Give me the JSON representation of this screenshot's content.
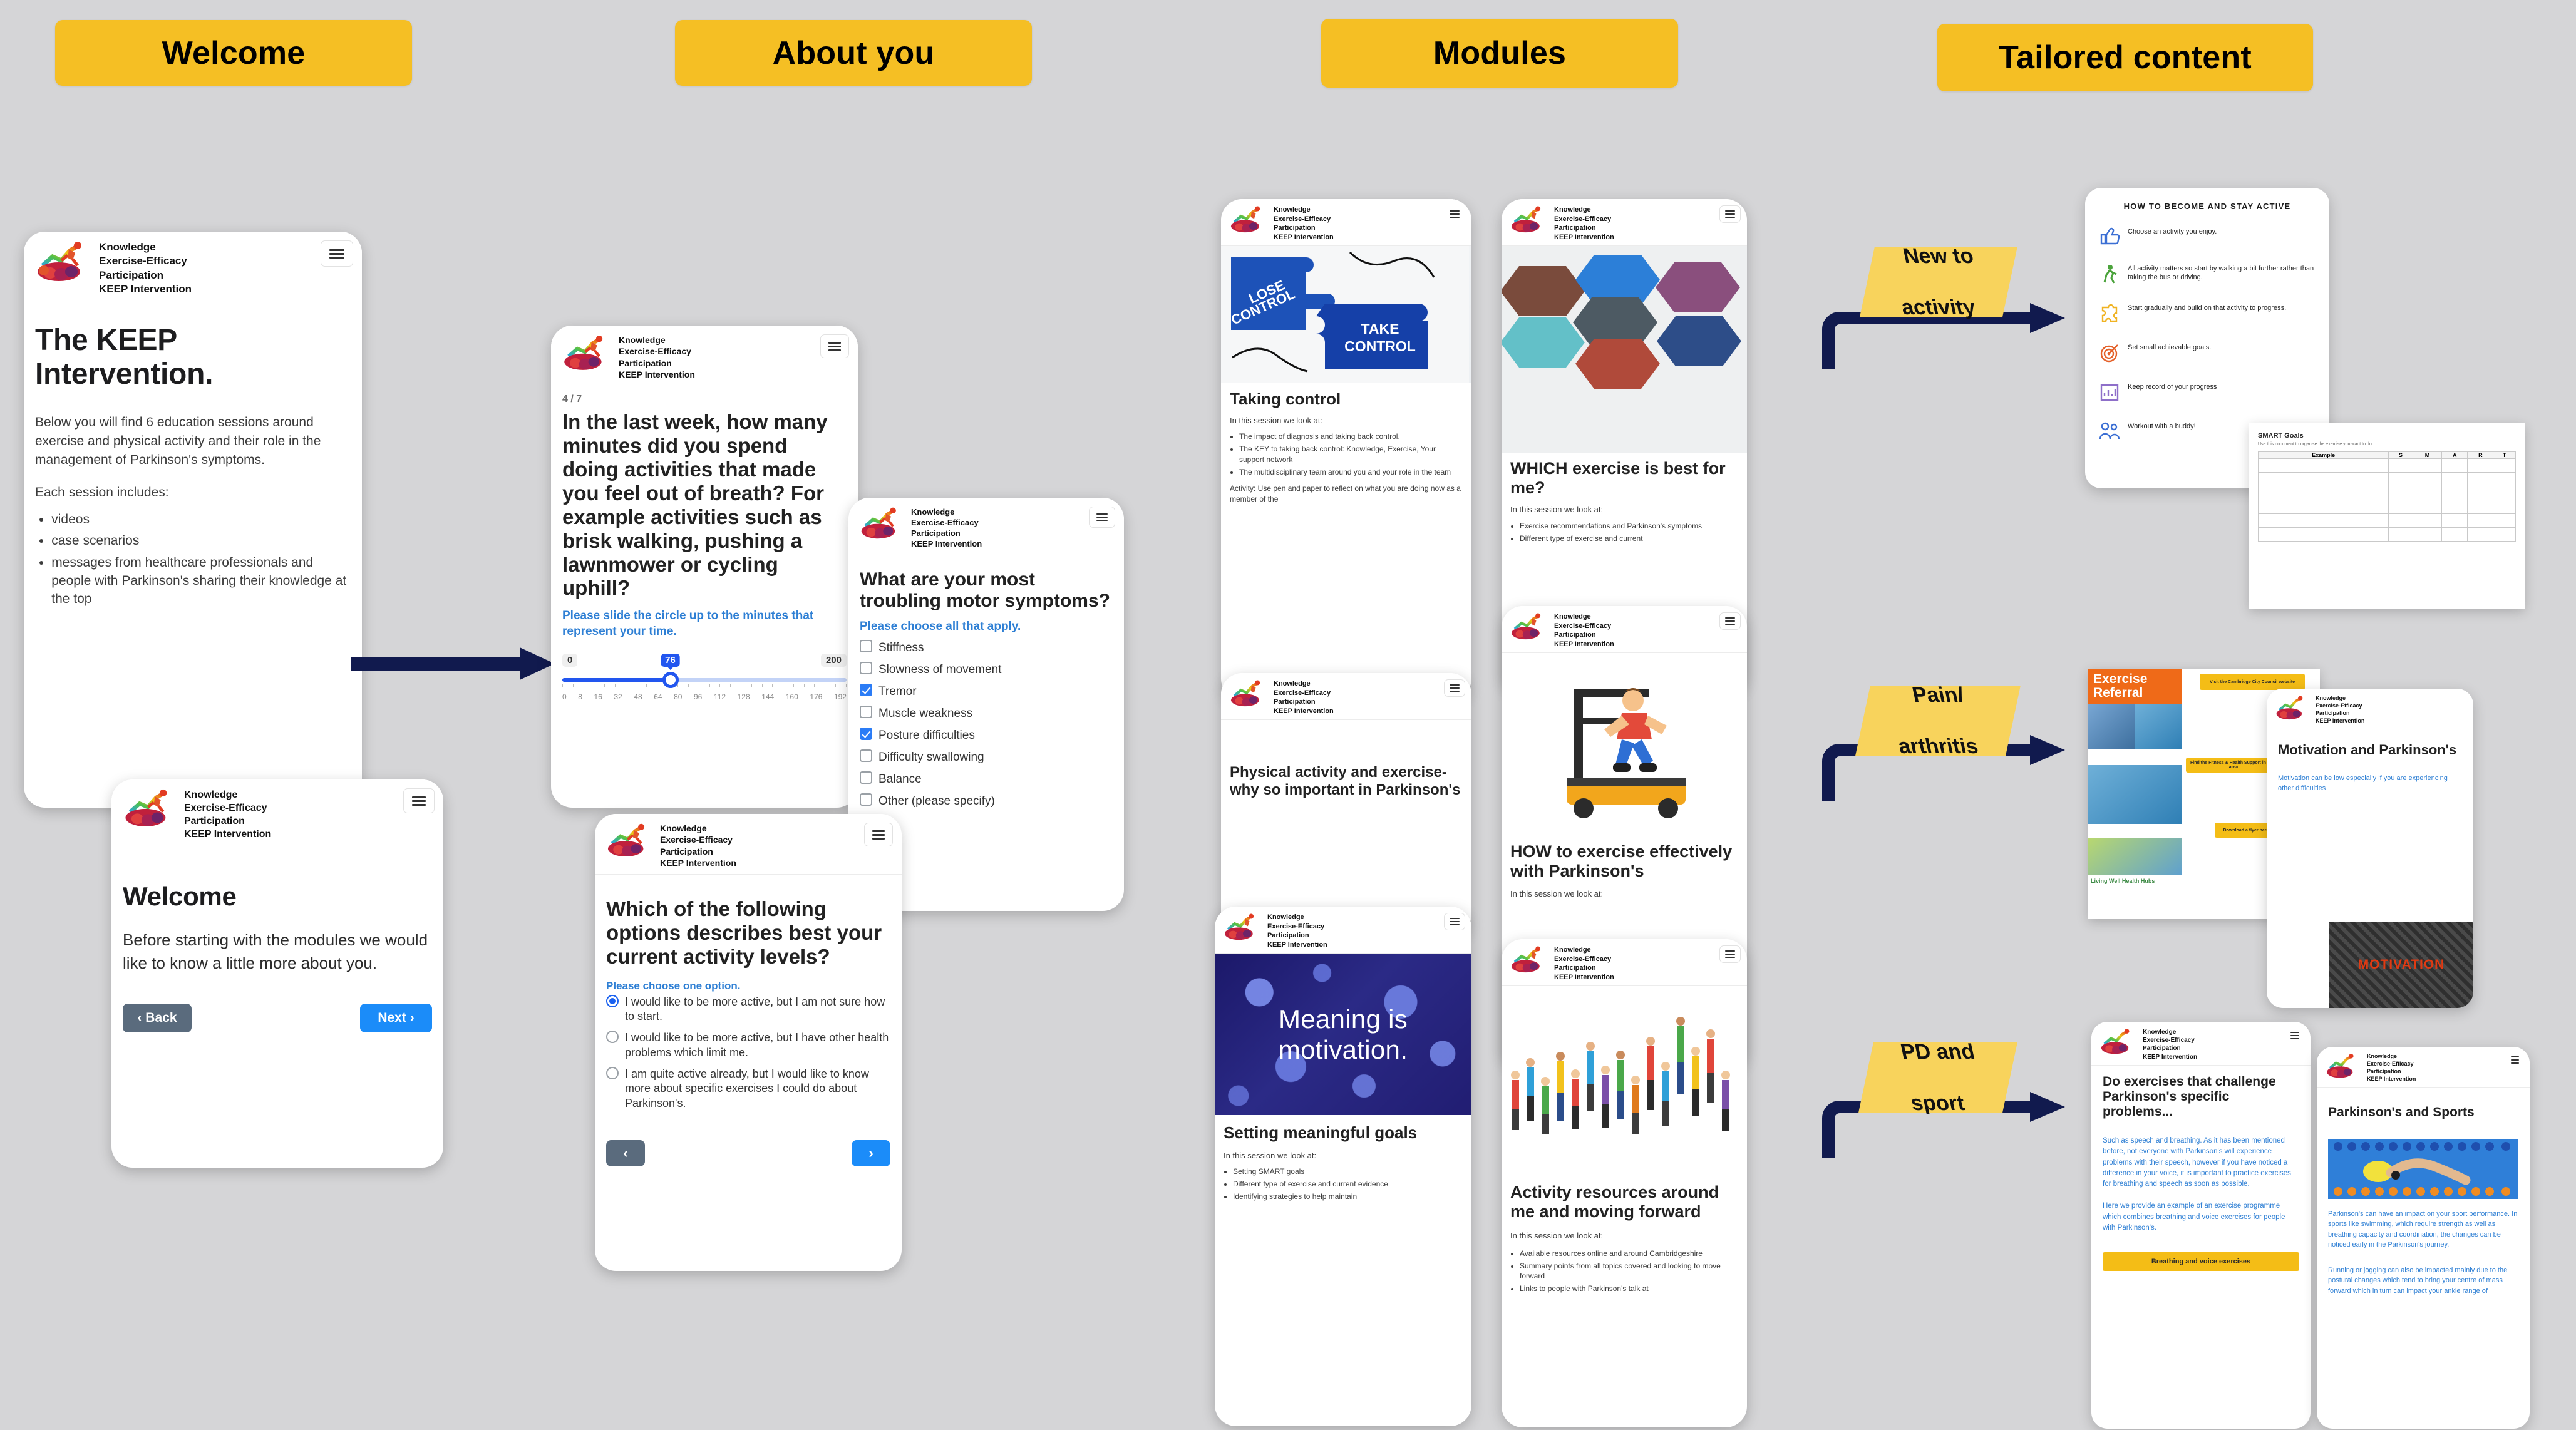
{
  "banners": [
    {
      "label": "Welcome"
    },
    {
      "label": "About you"
    },
    {
      "label": "Modules"
    },
    {
      "label": "Tailored content"
    }
  ],
  "brand": {
    "line1": "Knowledge",
    "line2": "Exercise-Efficacy",
    "line3": "Participation",
    "line4": "KEEP Intervention",
    "logo_icon": "running-figure-logo"
  },
  "welcome_column": {
    "keep_card": {
      "title": "The KEEP Intervention.",
      "paragraph": "Below you will find 6 education sessions around exercise and physical activity and their role in the management of Parkinson's symptoms.",
      "list_intro": "Each session includes:",
      "bullets": [
        "videos",
        "case scenarios",
        "messages from healthcare professionals and people with Parkinson's sharing their knowledge at the top"
      ]
    },
    "welcome_card": {
      "title": "Welcome",
      "paragraph": "Before starting with the modules we would like to know a little more about you.",
      "back_label": "‹ Back",
      "next_label": "Next ›"
    }
  },
  "about_you_column": {
    "minutes_card": {
      "step": "4 / 7",
      "question": "In the last week, how many minutes did you spend doing activities that made you feel out of breath? For example activities such as brisk walking, pushing a lawnmower or cycling uphill?",
      "hint": "Please slide the circle up to the minutes that represent your time.",
      "slider": {
        "min_label": "0",
        "max_label": "200",
        "value": "76",
        "min": 0,
        "max": 200,
        "ticks": [
          "0",
          "8",
          "16",
          "32",
          "48",
          "64",
          "80",
          "96",
          "112",
          "128",
          "144",
          "160",
          "176",
          "192"
        ]
      }
    },
    "symptoms_card": {
      "question": "What are your most troubling motor symptoms?",
      "hint": "Please choose all that apply.",
      "options": [
        {
          "label": "Stiffness",
          "checked": false
        },
        {
          "label": "Slowness of movement",
          "checked": false
        },
        {
          "label": "Tremor",
          "checked": true
        },
        {
          "label": "Muscle weakness",
          "checked": false
        },
        {
          "label": "Posture difficulties",
          "checked": true
        },
        {
          "label": "Difficulty swallowing",
          "checked": false
        },
        {
          "label": "Balance",
          "checked": false
        },
        {
          "label": "Other (please specify)",
          "checked": false
        }
      ]
    },
    "activity_card": {
      "question": "Which of the following options describes best your current activity levels?",
      "hint": "Please choose one option.",
      "options": [
        {
          "label": "I would like to be more active, but I am not sure how to start.",
          "selected": true
        },
        {
          "label": "I would like to be more active, but I have other health problems which limit me.",
          "selected": false
        },
        {
          "label": "I am quite active already, but I would like to know more about specific exercises I could do about Parkinson's.",
          "selected": false
        }
      ],
      "back_label": "‹",
      "next_label": "›"
    }
  },
  "modules_column": {
    "taking_control": {
      "image_left_label": "LOSE CONTROL",
      "image_right_label": "TAKE CONTROL",
      "title": "Taking control",
      "intro": "In this session we look at:",
      "bullets": [
        "The impact of diagnosis and taking back control.",
        "The KEY to taking back control: Knowledge, Exercise, Your support network",
        "The multidisciplinary team around you and your role in the team"
      ],
      "activity": "Activity: Use pen and paper to reflect on what you are doing now as a member of the"
    },
    "physical_activity": {
      "title": "Physical activity and exercise- why so important in Parkinson's"
    },
    "meaningful_goals": {
      "image_caption": "Meaning is motivation.",
      "title": "Setting meaningful goals",
      "intro": "In this session we look at:",
      "bullets": [
        "Setting SMART goals",
        "Different type of exercise and current evidence",
        "Identifying strategies to help maintain"
      ]
    },
    "which_exercise": {
      "title": "WHICH exercise is best for me?",
      "intro": "In this session we look at:",
      "bullets": [
        "Exercise recommendations and Parkinson's symptoms",
        "Different type of exercise and current"
      ]
    },
    "how_to_exercise": {
      "title": "HOW to exercise effectively with Parkinson's",
      "intro": "In this session we look at:"
    },
    "activity_resources": {
      "title": "Activity resources around me and moving forward",
      "intro": "In this session we look at:",
      "bullets": [
        "Available resources online and around Cambridgeshire",
        "Summary points from all topics covered and looking to move forward",
        "Links to people with Parkinson's talk at"
      ]
    }
  },
  "tailored_column": {
    "tags": [
      {
        "line1": "New to",
        "line2": "activity"
      },
      {
        "line1": "Pain/",
        "line2": "arthritis"
      },
      {
        "line1": "PD and",
        "line2": "sport"
      }
    ],
    "active_infographic": {
      "title": "HOW TO BECOME AND STAY ACTIVE",
      "rows": [
        {
          "icon": "thumbs-up-icon",
          "color": "#3b6fd4",
          "text": "Choose an activity you enjoy."
        },
        {
          "icon": "walking-person-icon",
          "color": "#4ba33c",
          "text": "All activity matters so start by walking a bit further rather than taking the bus or driving."
        },
        {
          "icon": "puzzle-piece-icon",
          "color": "#f0b323",
          "text": "Start gradually and build on that activity to progress."
        },
        {
          "icon": "target-icon",
          "color": "#e4612a",
          "text": "Set small achievable goals."
        },
        {
          "icon": "chart-clipboard-icon",
          "color": "#8e6fc9",
          "text": "Keep record of your progress"
        },
        {
          "icon": "people-icon",
          "color": "#3b6fd4",
          "text": "Workout with a buddy!"
        }
      ]
    },
    "smart_goals_sheet": {
      "title": "SMART Goals",
      "subtitle": "Use this document to organise the exercise you want to do.",
      "headers": [
        "Example",
        "S",
        "M",
        "A",
        "R",
        "T"
      ]
    },
    "motivation_card": {
      "title": "Motivation and Parkinson's",
      "body": "Motivation can be low especially if you are experiencing other difficulties",
      "motivation_word": "MOTIVATION"
    },
    "referral_sheet": {
      "heading_line1": "Exercise",
      "heading_line2": "Referral",
      "chips": [
        "Visit the Cambridge City Council website",
        "Find the Fitness & Health Support in your area",
        "Download a flyer here"
      ],
      "footer_title": "Living Well Health Hubs"
    },
    "pd_sport_card": {
      "title": "Do exercises that challenge Parkinson's specific problems...",
      "para1": "Such as speech and breathing. As it has been mentioned before, not everyone with Parkinson's will experience problems with their speech, however if you have noticed a difference in your voice, it is important to practice exercises for breathing and speech as soon as possible.",
      "para2": "Here we provide an example of an exercise programme which combines breathing and voice exercises for people with Parkinson's.",
      "button_label": "Breathing and voice exercises"
    },
    "sports_card": {
      "title": "Parkinson's and Sports",
      "para1": "Parkinson's can have an impact on your sport performance. In sports like swimming, which require strength as well as breathing capacity and coordination, the changes can be noticed early in the Parkinson's journey.",
      "para2": "Running or jogging can also be impacted mainly due to the postural changes which tend to bring your centre of mass forward which in turn can impact your ankle range of"
    }
  },
  "colors": {
    "background": "#d5d5d7",
    "banner_yellow": "#f5bf24",
    "tag_yellow": "#f8d35c",
    "arrow_navy": "#111a4e",
    "accent_blue": "#2b7cf6",
    "link_blue": "#2e7fd4"
  }
}
